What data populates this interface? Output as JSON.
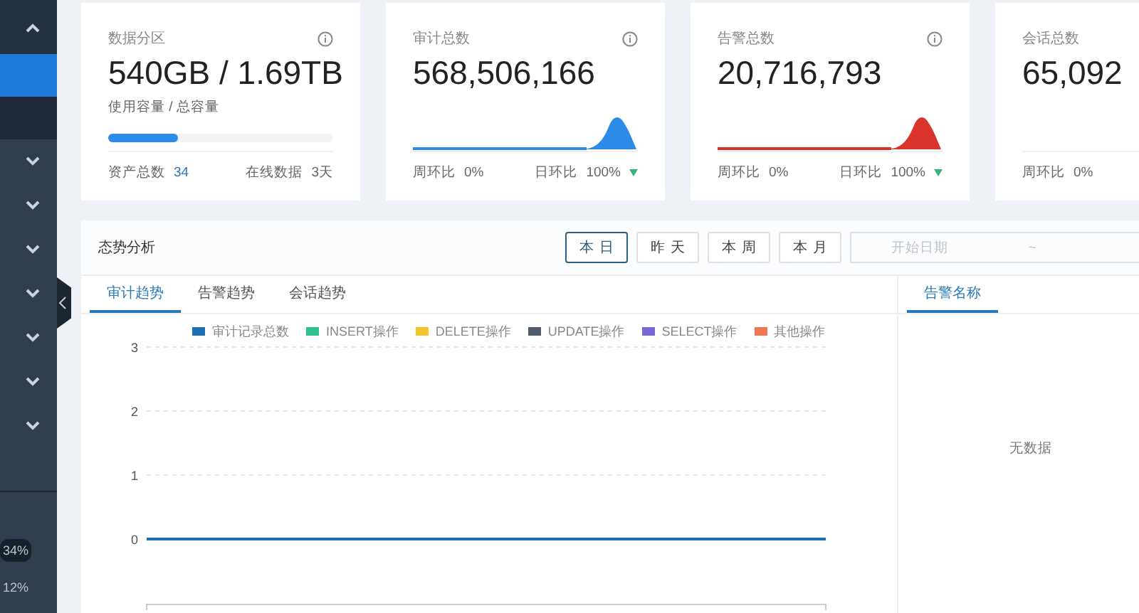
{
  "sidebar": {
    "menu": [
      {
        "expanded": true,
        "children": [
          {
            "selected": true
          },
          {
            "selected": false
          }
        ]
      },
      {
        "expanded": false
      },
      {
        "expanded": false
      },
      {
        "expanded": false
      },
      {
        "expanded": false
      },
      {
        "expanded": false
      },
      {
        "expanded": false
      },
      {
        "expanded": false
      }
    ],
    "usage": [
      {
        "label": "34%",
        "highlighted": true
      },
      {
        "label": "12%",
        "highlighted": false
      }
    ]
  },
  "cards": [
    {
      "kind": "storage",
      "title": "数据分区",
      "info": true,
      "value": "540GB / 1.69TB",
      "caption": "使用容量 / 总容量",
      "level": 0.31,
      "footer_left_label": "资产总数",
      "footer_left_value": "34",
      "footer_right_label": "在线数据",
      "footer_right_value": "3天"
    },
    {
      "kind": "trend",
      "title": "审计总数",
      "info": true,
      "value": "568,506,166",
      "color": "#2b8be6",
      "weekly_label": "周环比",
      "weekly_value": "0%",
      "daily_label": "日环比",
      "daily_value": "100%"
    },
    {
      "kind": "trend",
      "title": "告警总数",
      "info": true,
      "value": "20,716,793",
      "color": "#d9332b",
      "weekly_label": "周环比",
      "weekly_value": "0%",
      "daily_label": "日环比",
      "daily_value": "100%"
    },
    {
      "kind": "trend",
      "title": "会话总数",
      "info": false,
      "value": "65,092",
      "weekly_label": "周环比",
      "weekly_value": "0%"
    }
  ],
  "trend_panel": {
    "title": "态势分析",
    "ranges": [
      {
        "label": "本日",
        "selected": true
      },
      {
        "label": "昨天",
        "selected": false
      },
      {
        "label": "本周",
        "selected": false
      },
      {
        "label": "本月",
        "selected": false
      }
    ],
    "date_range": {
      "start_placeholder": "开始日期",
      "separator": "~"
    },
    "tabs": [
      {
        "label": "审计趋势",
        "selected": true
      },
      {
        "label": "告警趋势",
        "selected": false
      },
      {
        "label": "会话趋势",
        "selected": false
      }
    ],
    "chart_data": {
      "type": "line",
      "legend": "top",
      "ylim": [
        0,
        3
      ],
      "yticks": [
        0,
        1,
        2,
        3
      ],
      "series": [
        {
          "name": "审计记录总数",
          "color": "#1f6fb5",
          "values": [
            0,
            0,
            0,
            0,
            0,
            0,
            0,
            0,
            0,
            0
          ]
        },
        {
          "name": "INSERT操作",
          "color": "#2fbf92",
          "values": [
            null,
            null,
            null,
            null,
            null,
            null,
            null,
            null,
            null,
            null
          ]
        },
        {
          "name": "DELETE操作",
          "color": "#f5c531",
          "values": [
            null,
            null,
            null,
            null,
            null,
            null,
            null,
            null,
            null,
            null
          ]
        },
        {
          "name": "UPDATE操作",
          "color": "#4f5b6a",
          "values": [
            null,
            null,
            null,
            null,
            null,
            null,
            null,
            null,
            null,
            null
          ]
        },
        {
          "name": "SELECT操作",
          "color": "#7b68d8",
          "values": [
            null,
            null,
            null,
            null,
            null,
            null,
            null,
            null,
            null,
            null
          ]
        },
        {
          "name": "其他操作",
          "color": "#f07654",
          "values": [
            null,
            null,
            null,
            null,
            null,
            null,
            null,
            null,
            null,
            null
          ]
        }
      ]
    },
    "side_tabs": [
      {
        "label": "告警名称",
        "selected": true
      }
    ],
    "empty_text": "无数据"
  }
}
